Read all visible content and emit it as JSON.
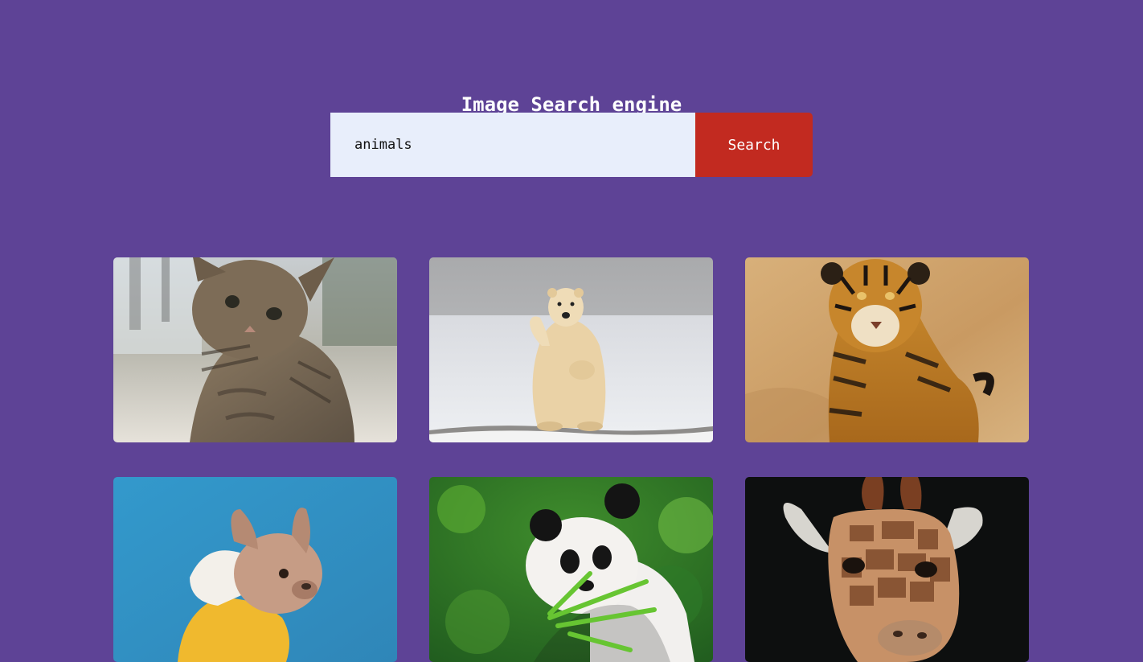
{
  "header": {
    "title": "Image Search engine"
  },
  "search": {
    "value": "animals",
    "button_label": "Search"
  },
  "results": [
    {
      "subject": "kitten",
      "icon": "kitten-photo"
    },
    {
      "subject": "polar bear",
      "icon": "polar-bear-photo"
    },
    {
      "subject": "tiger",
      "icon": "tiger-photo"
    },
    {
      "subject": "french bulldog",
      "icon": "bulldog-photo"
    },
    {
      "subject": "panda",
      "icon": "panda-photo"
    },
    {
      "subject": "giraffe",
      "icon": "giraffe-photo"
    }
  ],
  "colors": {
    "background": "#5e4396",
    "input_bg": "#e8eefb",
    "button_bg": "#c22a20",
    "text_light": "#ffffff"
  }
}
